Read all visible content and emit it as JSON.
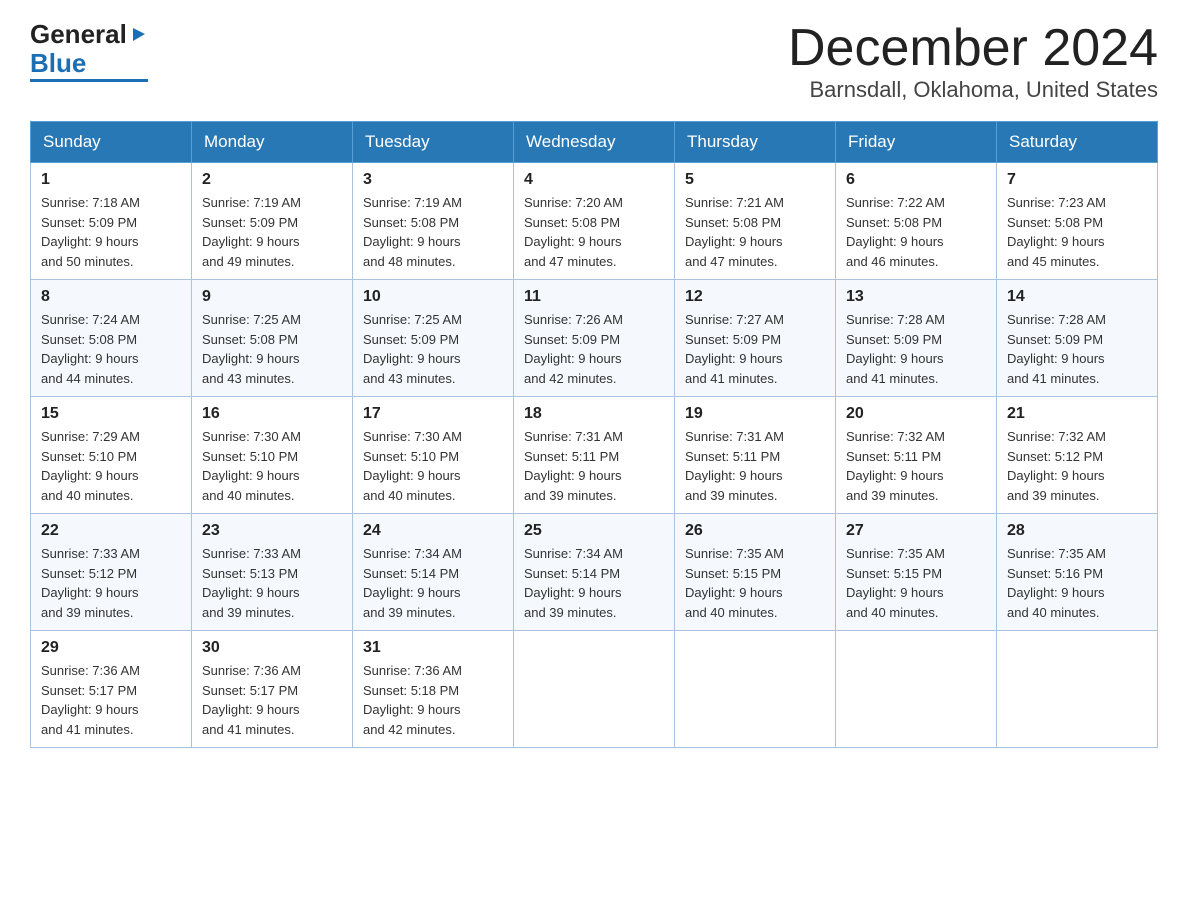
{
  "header": {
    "logo_general": "General",
    "logo_blue": "Blue",
    "month_title": "December 2024",
    "location": "Barnsdall, Oklahoma, United States"
  },
  "weekdays": [
    "Sunday",
    "Monday",
    "Tuesday",
    "Wednesday",
    "Thursday",
    "Friday",
    "Saturday"
  ],
  "weeks": [
    [
      {
        "day": "1",
        "sunrise": "7:18 AM",
        "sunset": "5:09 PM",
        "daylight": "9 hours and 50 minutes."
      },
      {
        "day": "2",
        "sunrise": "7:19 AM",
        "sunset": "5:09 PM",
        "daylight": "9 hours and 49 minutes."
      },
      {
        "day": "3",
        "sunrise": "7:19 AM",
        "sunset": "5:08 PM",
        "daylight": "9 hours and 48 minutes."
      },
      {
        "day": "4",
        "sunrise": "7:20 AM",
        "sunset": "5:08 PM",
        "daylight": "9 hours and 47 minutes."
      },
      {
        "day": "5",
        "sunrise": "7:21 AM",
        "sunset": "5:08 PM",
        "daylight": "9 hours and 47 minutes."
      },
      {
        "day": "6",
        "sunrise": "7:22 AM",
        "sunset": "5:08 PM",
        "daylight": "9 hours and 46 minutes."
      },
      {
        "day": "7",
        "sunrise": "7:23 AM",
        "sunset": "5:08 PM",
        "daylight": "9 hours and 45 minutes."
      }
    ],
    [
      {
        "day": "8",
        "sunrise": "7:24 AM",
        "sunset": "5:08 PM",
        "daylight": "9 hours and 44 minutes."
      },
      {
        "day": "9",
        "sunrise": "7:25 AM",
        "sunset": "5:08 PM",
        "daylight": "9 hours and 43 minutes."
      },
      {
        "day": "10",
        "sunrise": "7:25 AM",
        "sunset": "5:09 PM",
        "daylight": "9 hours and 43 minutes."
      },
      {
        "day": "11",
        "sunrise": "7:26 AM",
        "sunset": "5:09 PM",
        "daylight": "9 hours and 42 minutes."
      },
      {
        "day": "12",
        "sunrise": "7:27 AM",
        "sunset": "5:09 PM",
        "daylight": "9 hours and 41 minutes."
      },
      {
        "day": "13",
        "sunrise": "7:28 AM",
        "sunset": "5:09 PM",
        "daylight": "9 hours and 41 minutes."
      },
      {
        "day": "14",
        "sunrise": "7:28 AM",
        "sunset": "5:09 PM",
        "daylight": "9 hours and 41 minutes."
      }
    ],
    [
      {
        "day": "15",
        "sunrise": "7:29 AM",
        "sunset": "5:10 PM",
        "daylight": "9 hours and 40 minutes."
      },
      {
        "day": "16",
        "sunrise": "7:30 AM",
        "sunset": "5:10 PM",
        "daylight": "9 hours and 40 minutes."
      },
      {
        "day": "17",
        "sunrise": "7:30 AM",
        "sunset": "5:10 PM",
        "daylight": "9 hours and 40 minutes."
      },
      {
        "day": "18",
        "sunrise": "7:31 AM",
        "sunset": "5:11 PM",
        "daylight": "9 hours and 39 minutes."
      },
      {
        "day": "19",
        "sunrise": "7:31 AM",
        "sunset": "5:11 PM",
        "daylight": "9 hours and 39 minutes."
      },
      {
        "day": "20",
        "sunrise": "7:32 AM",
        "sunset": "5:11 PM",
        "daylight": "9 hours and 39 minutes."
      },
      {
        "day": "21",
        "sunrise": "7:32 AM",
        "sunset": "5:12 PM",
        "daylight": "9 hours and 39 minutes."
      }
    ],
    [
      {
        "day": "22",
        "sunrise": "7:33 AM",
        "sunset": "5:12 PM",
        "daylight": "9 hours and 39 minutes."
      },
      {
        "day": "23",
        "sunrise": "7:33 AM",
        "sunset": "5:13 PM",
        "daylight": "9 hours and 39 minutes."
      },
      {
        "day": "24",
        "sunrise": "7:34 AM",
        "sunset": "5:14 PM",
        "daylight": "9 hours and 39 minutes."
      },
      {
        "day": "25",
        "sunrise": "7:34 AM",
        "sunset": "5:14 PM",
        "daylight": "9 hours and 39 minutes."
      },
      {
        "day": "26",
        "sunrise": "7:35 AM",
        "sunset": "5:15 PM",
        "daylight": "9 hours and 40 minutes."
      },
      {
        "day": "27",
        "sunrise": "7:35 AM",
        "sunset": "5:15 PM",
        "daylight": "9 hours and 40 minutes."
      },
      {
        "day": "28",
        "sunrise": "7:35 AM",
        "sunset": "5:16 PM",
        "daylight": "9 hours and 40 minutes."
      }
    ],
    [
      {
        "day": "29",
        "sunrise": "7:36 AM",
        "sunset": "5:17 PM",
        "daylight": "9 hours and 41 minutes."
      },
      {
        "day": "30",
        "sunrise": "7:36 AM",
        "sunset": "5:17 PM",
        "daylight": "9 hours and 41 minutes."
      },
      {
        "day": "31",
        "sunrise": "7:36 AM",
        "sunset": "5:18 PM",
        "daylight": "9 hours and 42 minutes."
      },
      null,
      null,
      null,
      null
    ]
  ],
  "labels": {
    "sunrise_prefix": "Sunrise: ",
    "sunset_prefix": "Sunset: ",
    "daylight_prefix": "Daylight: "
  }
}
